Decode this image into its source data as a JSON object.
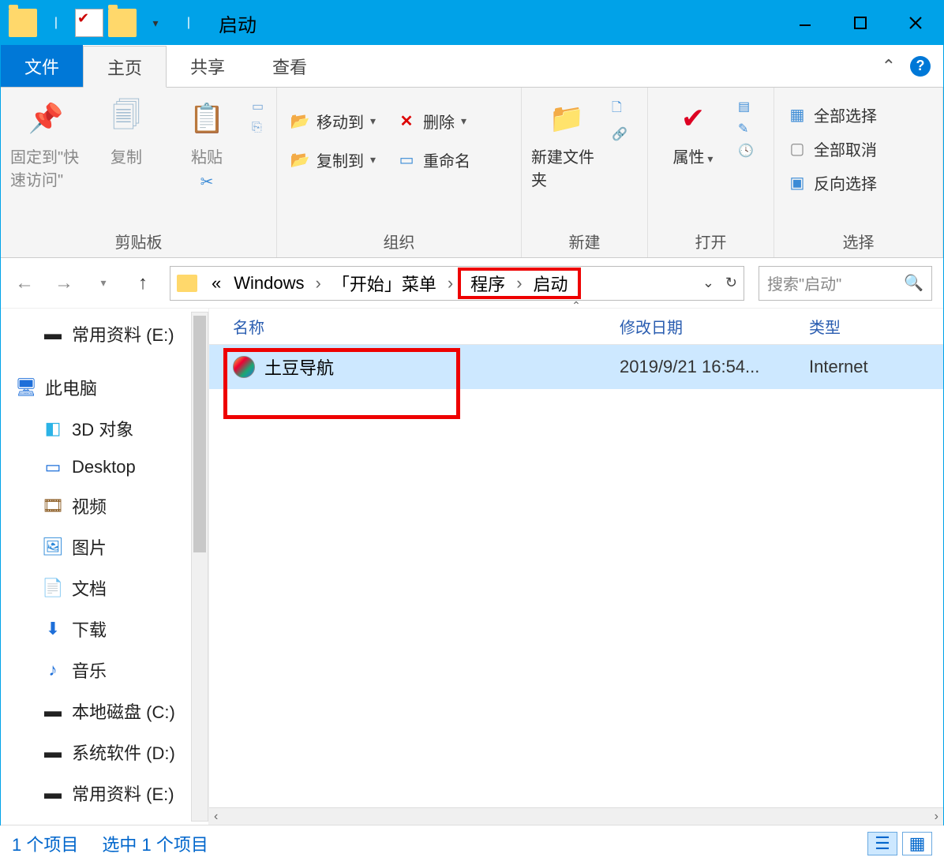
{
  "titlebar": {
    "title": "启动"
  },
  "tabs": {
    "file": "文件",
    "home": "主页",
    "share": "共享",
    "view": "查看"
  },
  "ribbon": {
    "pin": "固定到\"快速访问\"",
    "copy": "复制",
    "paste": "粘贴",
    "clipboard_label": "剪贴板",
    "moveto": "移动到",
    "copyto": "复制到",
    "delete": "删除",
    "rename": "重命名",
    "organize_label": "组织",
    "newfolder": "新建文件夹",
    "new_label": "新建",
    "properties": "属性",
    "open_label": "打开",
    "selectall": "全部选择",
    "selectnone": "全部取消",
    "invert": "反向选择",
    "select_label": "选择"
  },
  "breadcrumb": {
    "prefix": "«",
    "p1": "Windows",
    "p2": "「开始」菜单",
    "p3": "程序",
    "p4": "启动"
  },
  "search": {
    "placeholder": "搜索\"启动\""
  },
  "nav": {
    "i0": "常用资料 (E:)",
    "i1": "此电脑",
    "i2": "3D 对象",
    "i3": "Desktop",
    "i4": "视频",
    "i5": "图片",
    "i6": "文档",
    "i7": "下载",
    "i8": "音乐",
    "i9": "本地磁盘 (C:)",
    "i10": "系统软件 (D:)",
    "i11": "常用资料 (E:)"
  },
  "cols": {
    "name": "名称",
    "date": "修改日期",
    "type": "类型"
  },
  "file": {
    "name": "土豆导航",
    "date": "2019/9/21 16:54...",
    "type": "Internet "
  },
  "status": {
    "count": "1 个项目",
    "sel": "选中 1 个项目"
  }
}
